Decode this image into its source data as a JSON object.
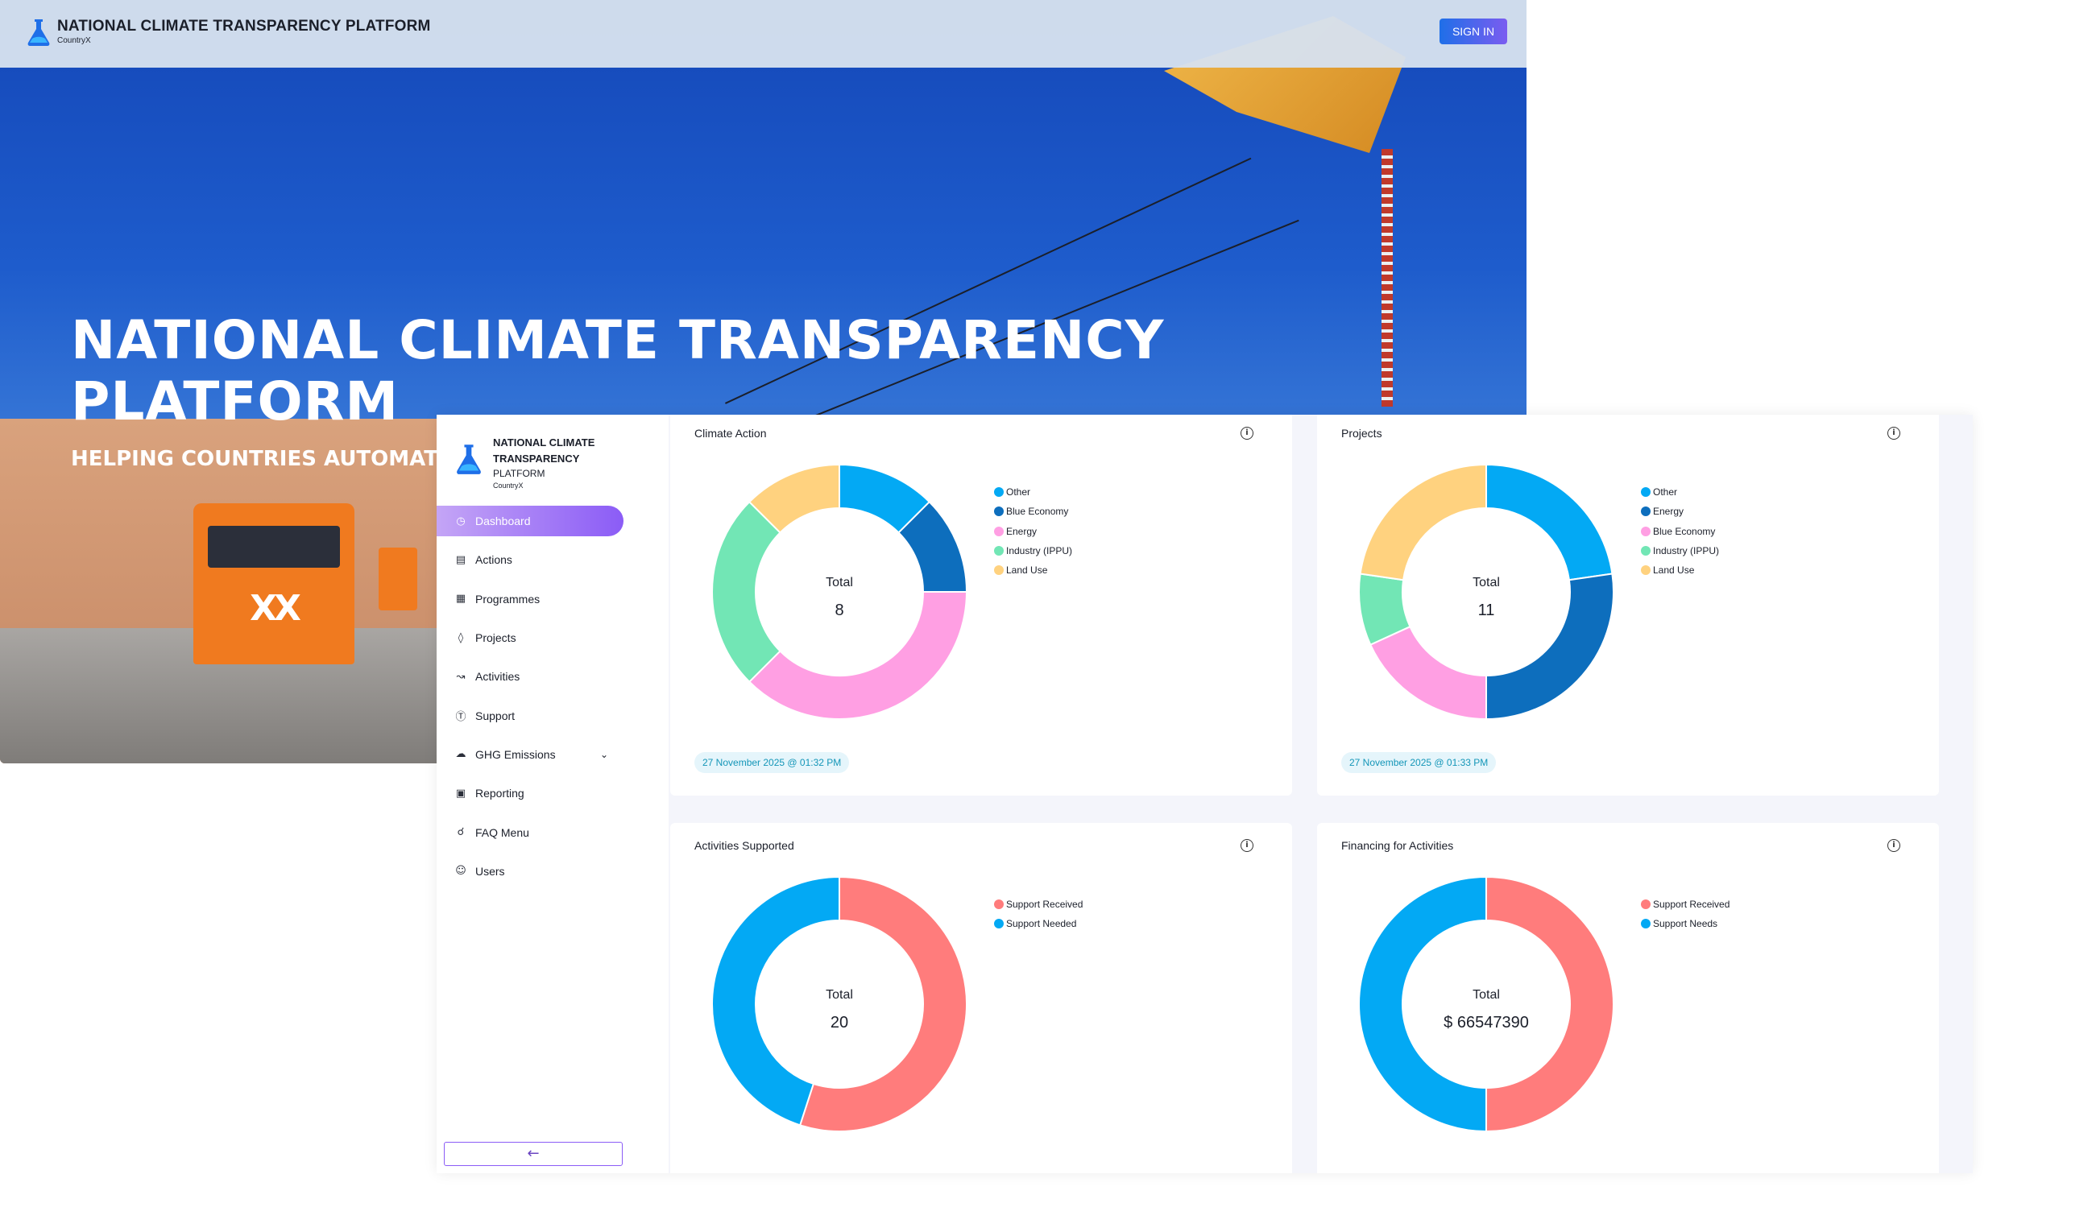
{
  "hero": {
    "brand_title": "NATIONAL CLIMATE TRANSPARENCY PLATFORM",
    "brand_sub": "CountryX",
    "sign_in_label": "SIGN IN",
    "headline": "NATIONAL CLIMATE TRANSPARENCY PLATFORM",
    "subheadline": "HELPING COUNTRIES AUTOMAT"
  },
  "sidebar": {
    "title": "NATIONAL CLIMATE TRANSPARENCY",
    "subtitle": "PLATFORM",
    "country": "CountryX",
    "items": [
      {
        "label": "Dashboard",
        "icon": "dashboard-icon",
        "active": true
      },
      {
        "label": "Actions",
        "icon": "clipboard-icon"
      },
      {
        "label": "Programmes",
        "icon": "grid-icon"
      },
      {
        "label": "Projects",
        "icon": "layers-icon"
      },
      {
        "label": "Activities",
        "icon": "line-chart-icon"
      },
      {
        "label": "Support",
        "icon": "dollar-icon"
      },
      {
        "label": "GHG Emissions",
        "icon": "cloud-icon",
        "expandable": true
      },
      {
        "label": "Reporting",
        "icon": "report-icon"
      },
      {
        "label": "FAQ Menu",
        "icon": "headset-icon"
      },
      {
        "label": "Users",
        "icon": "user-icon"
      }
    ],
    "collapse_icon": "arrow-left-icon"
  },
  "colors": {
    "other": "#03a9f4",
    "dark_blue": "#0d6ebd",
    "pink": "#ff9fe3",
    "green": "#72e6b5",
    "yellow": "#ffd27f",
    "support_received": "#ff7c7c",
    "support_needed": "#03a9f4",
    "accent": "#8b5cf6"
  },
  "cards": [
    {
      "title": "Climate Action",
      "total_label": "Total",
      "total_value": "8",
      "timestamp": "27 November 2025 @ 01:32 PM",
      "legend": [
        {
          "label": "Other",
          "color": "#03a9f4"
        },
        {
          "label": "Blue Economy",
          "color": "#0d6ebd"
        },
        {
          "label": "Energy",
          "color": "#ff9fe3"
        },
        {
          "label": "Industry (IPPU)",
          "color": "#72e6b5"
        },
        {
          "label": "Land Use",
          "color": "#ffd27f"
        }
      ]
    },
    {
      "title": "Projects",
      "total_label": "Total",
      "total_value": "11",
      "timestamp": "27 November 2025 @ 01:33 PM",
      "legend": [
        {
          "label": "Other",
          "color": "#03a9f4"
        },
        {
          "label": "Energy",
          "color": "#0d6ebd"
        },
        {
          "label": "Blue Economy",
          "color": "#ff9fe3"
        },
        {
          "label": "Industry (IPPU)",
          "color": "#72e6b5"
        },
        {
          "label": "Land Use",
          "color": "#ffd27f"
        }
      ]
    },
    {
      "title": "Activities Supported",
      "total_label": "Total",
      "total_value": "20",
      "legend": [
        {
          "label": "Support Received",
          "color": "#ff7c7c"
        },
        {
          "label": "Support Needed",
          "color": "#03a9f4"
        }
      ]
    },
    {
      "title": "Financing for Activities",
      "total_label": "Total",
      "total_value": "$ 66547390",
      "legend": [
        {
          "label": "Support Received",
          "color": "#ff7c7c"
        },
        {
          "label": "Support Needs",
          "color": "#03a9f4"
        }
      ]
    }
  ],
  "chart_data": [
    {
      "type": "pie",
      "title": "Climate Action",
      "categories": [
        "Other",
        "Blue Economy",
        "Energy",
        "Industry (IPPU)",
        "Land Use"
      ],
      "values": [
        1,
        1,
        3,
        2,
        1
      ],
      "colors": [
        "#03a9f4",
        "#0d6ebd",
        "#ff9fe3",
        "#72e6b5",
        "#ffd27f"
      ]
    },
    {
      "type": "pie",
      "title": "Projects",
      "categories": [
        "Other",
        "Energy",
        "Blue Economy",
        "Industry (IPPU)",
        "Land Use"
      ],
      "values": [
        2.5,
        3,
        2,
        1,
        2.5
      ],
      "colors": [
        "#03a9f4",
        "#0d6ebd",
        "#ff9fe3",
        "#72e6b5",
        "#ffd27f"
      ]
    },
    {
      "type": "pie",
      "title": "Activities Supported",
      "categories": [
        "Support Received",
        "Support Needed"
      ],
      "values": [
        11,
        9
      ],
      "colors": [
        "#ff7c7c",
        "#03a9f4"
      ]
    },
    {
      "type": "pie",
      "title": "Financing for Activities",
      "categories": [
        "Support Received",
        "Support Needs"
      ],
      "values": [
        33273695,
        33273695
      ],
      "colors": [
        "#ff7c7c",
        "#03a9f4"
      ]
    }
  ]
}
